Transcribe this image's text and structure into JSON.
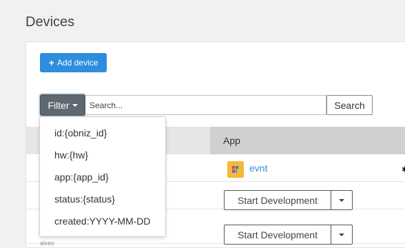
{
  "page": {
    "title": "Devices"
  },
  "toolbar": {
    "add_device_label": "Add device",
    "filter_label": "Filter",
    "search_placeholder": "Search...",
    "search_button_label": "Search"
  },
  "table": {
    "columns": [
      "",
      "App"
    ],
    "rows": [
      {
        "app_name": "evnt",
        "app_icon": "app-logo-icon",
        "action_label": ""
      },
      {
        "app_name": "",
        "action_label": "Start Development"
      },
      {
        "app_name": "",
        "action_label": "Start Development",
        "subtext": "aivec"
      }
    ]
  },
  "filter_menu": {
    "items": [
      "id:{obniz_id}",
      "hw:{hw}",
      "app:{app_id}",
      "status:{status}",
      "created:YYYY-MM-DD"
    ]
  },
  "colors": {
    "primary": "#2e8ddd",
    "filter_button": "#5f6870",
    "header_app": "#d0d0d2",
    "app_icon_bg": "#f2b93a"
  }
}
